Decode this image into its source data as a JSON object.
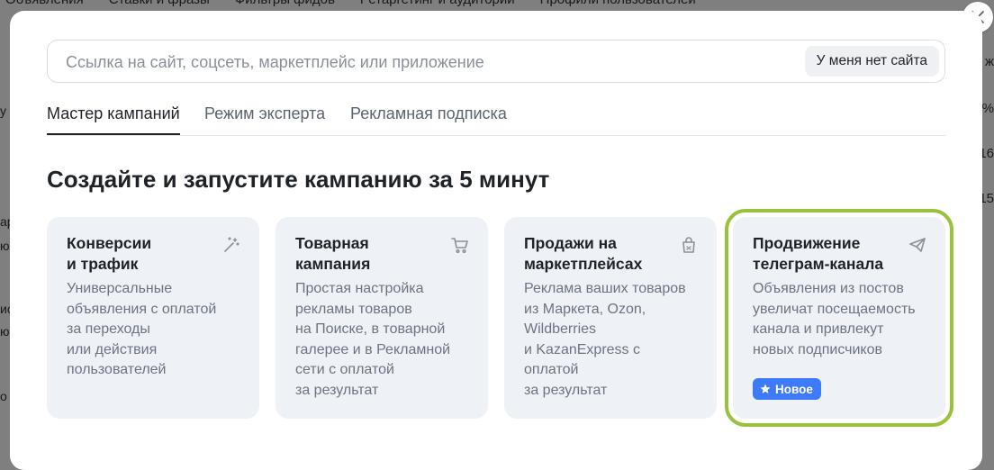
{
  "background": {
    "tabs": [
      "Объявления",
      "Ставки и фразы",
      "Фильтры фидов",
      "Ретаргетинг и аудитории",
      "Профили пользователей"
    ],
    "right_fragments": [
      "ж",
      "%",
      "16",
      "15"
    ],
    "left_fragments": [
      "у",
      "ар",
      "ю",
      "ис",
      "ю",
      "о"
    ]
  },
  "modal": {
    "search": {
      "placeholder": "Ссылка на сайт, соцсеть, маркетплейс или приложение",
      "value": "",
      "no_site_button": "У меня нет сайта"
    },
    "tabs": [
      {
        "label": "Мастер кампаний",
        "active": true
      },
      {
        "label": "Режим эксперта",
        "active": false
      },
      {
        "label": "Рекламная подписка",
        "active": false
      }
    ],
    "headline": "Создайте и запустите кампанию за 5 минут",
    "cards": [
      {
        "title": "Конверсии\nи трафик",
        "description": "Универсальные\nобъявления с оплатой\nза переходы\nили действия\nпользователей",
        "icon": "magic-wand-icon"
      },
      {
        "title": "Товарная\nкампания",
        "description": "Простая настройка\nрекламы товаров\nна Поиске, в товарной\nгалерее и в Рекламной\nсети с оплатой\nза результат",
        "icon": "cart-icon"
      },
      {
        "title": "Продажи на\nмаркетплейсах",
        "description": "Реклама ваших товаров\nиз Маркета, Ozon,\nWildberries\nи KazanExpress с оплатой\nза результат",
        "icon": "shopping-bag-icon"
      },
      {
        "title": "Продвижение\nтелеграм-канала",
        "description": "Объявления из постов\nувеличат посещаемость\nканала и привлекут\nновых подписчиков",
        "icon": "telegram-plane-icon",
        "badge": "Новое",
        "selected": true
      }
    ]
  },
  "colors": {
    "accent_badge": "#3e7bfa",
    "selection_outline": "#99c13b",
    "card_bg": "#eef1f6"
  }
}
